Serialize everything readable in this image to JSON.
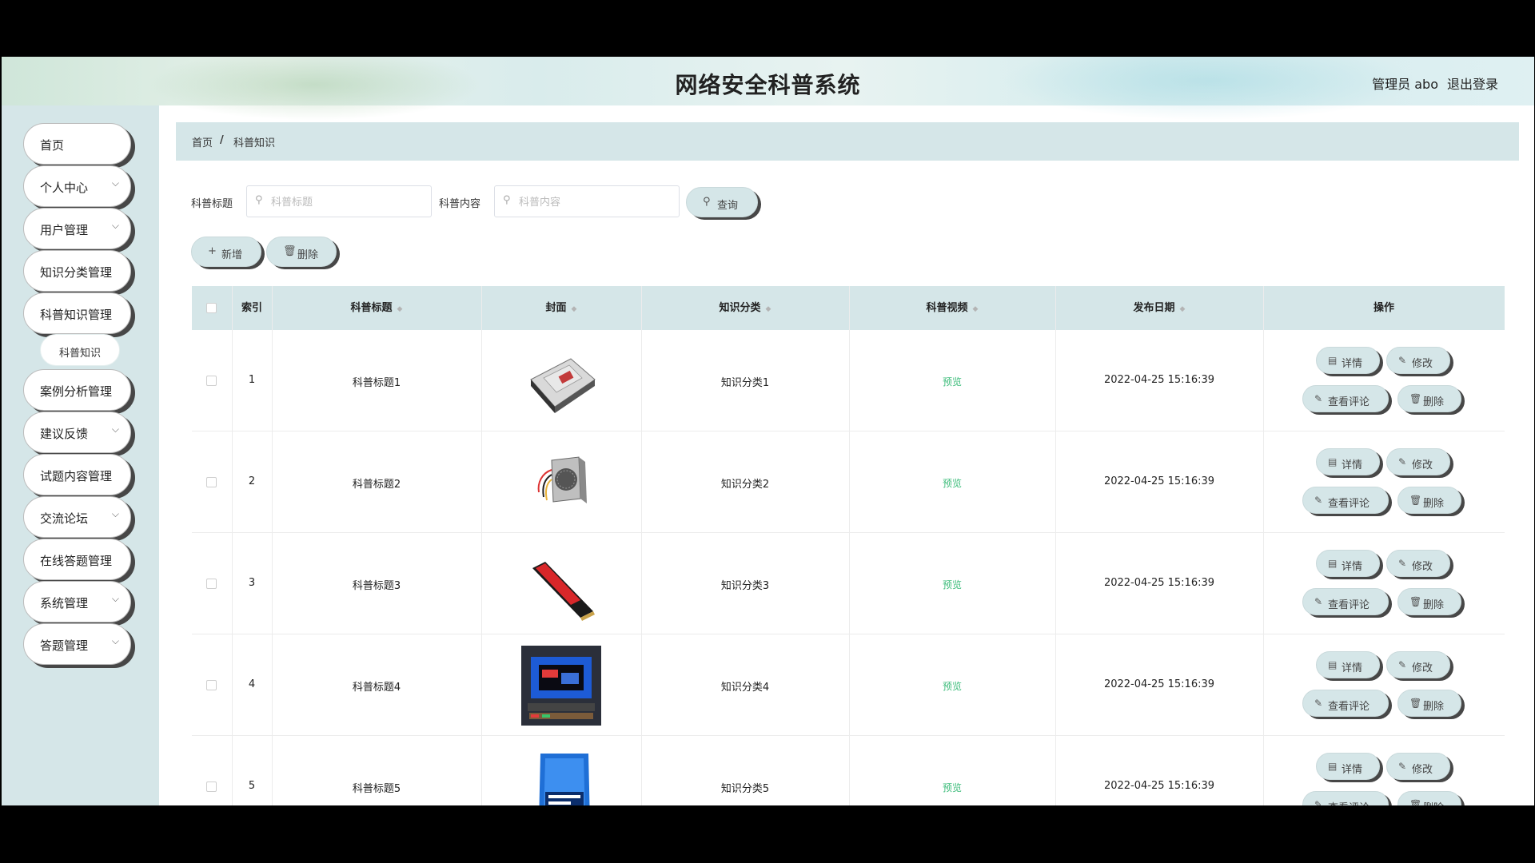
{
  "header": {
    "title": "网络安全科普系统",
    "user": "管理员 abo",
    "logout": "退出登录"
  },
  "sidebar": {
    "items": [
      {
        "label": "首页",
        "has_submenu": false
      },
      {
        "label": "个人中心",
        "has_submenu": true
      },
      {
        "label": "用户管理",
        "has_submenu": true
      },
      {
        "label": "知识分类管理",
        "has_submenu": false
      },
      {
        "label": "科普知识管理",
        "has_submenu": false
      },
      {
        "label": "科普知识",
        "is_subitem": true
      },
      {
        "label": "案例分析管理",
        "has_submenu": false
      },
      {
        "label": "建议反馈",
        "has_submenu": true
      },
      {
        "label": "试题内容管理",
        "has_submenu": false
      },
      {
        "label": "交流论坛",
        "has_submenu": true
      },
      {
        "label": "在线答题管理",
        "has_submenu": false
      },
      {
        "label": "系统管理",
        "has_submenu": true
      },
      {
        "label": "答题管理",
        "has_submenu": true
      }
    ]
  },
  "breadcrumb": {
    "home": "首页",
    "separator": "/",
    "current": "科普知识"
  },
  "search": {
    "title_label": "科普标题",
    "title_placeholder": "科普标题",
    "content_label": "科普内容",
    "content_placeholder": "科普内容",
    "query_button": "查询"
  },
  "actions": {
    "add": "新增",
    "delete": "删除"
  },
  "table": {
    "headers": {
      "index": "索引",
      "title": "科普标题",
      "cover": "封面",
      "category": "知识分类",
      "video": "科普视频",
      "date": "发布日期",
      "ops": "操作"
    },
    "rows": [
      {
        "index": "1",
        "title": "科普标题1",
        "category": "知识分类1",
        "video": "预览",
        "date": "2022-04-25 15:16:39",
        "cover": "hard-drive"
      },
      {
        "index": "2",
        "title": "科普标题2",
        "category": "知识分类2",
        "video": "预览",
        "date": "2022-04-25 15:16:39",
        "cover": "power-supply"
      },
      {
        "index": "3",
        "title": "科普标题3",
        "category": "知识分类3",
        "video": "预览",
        "date": "2022-04-25 15:16:39",
        "cover": "ram-stick"
      },
      {
        "index": "4",
        "title": "科普标题4",
        "category": "知识分类4",
        "video": "预览",
        "date": "2022-04-25 15:16:39",
        "cover": "monitor"
      },
      {
        "index": "5",
        "title": "科普标题5",
        "category": "知识分类5",
        "video": "预览",
        "date": "2022-04-25 15:16:39",
        "cover": "cpu-box"
      }
    ],
    "row_actions": {
      "detail": "详情",
      "edit": "修改",
      "comments": "查看评论",
      "delete": "删除"
    }
  },
  "colors": {
    "accent": "#d5e6e8",
    "shadow": "#474747",
    "link": "#3cbc7a"
  }
}
